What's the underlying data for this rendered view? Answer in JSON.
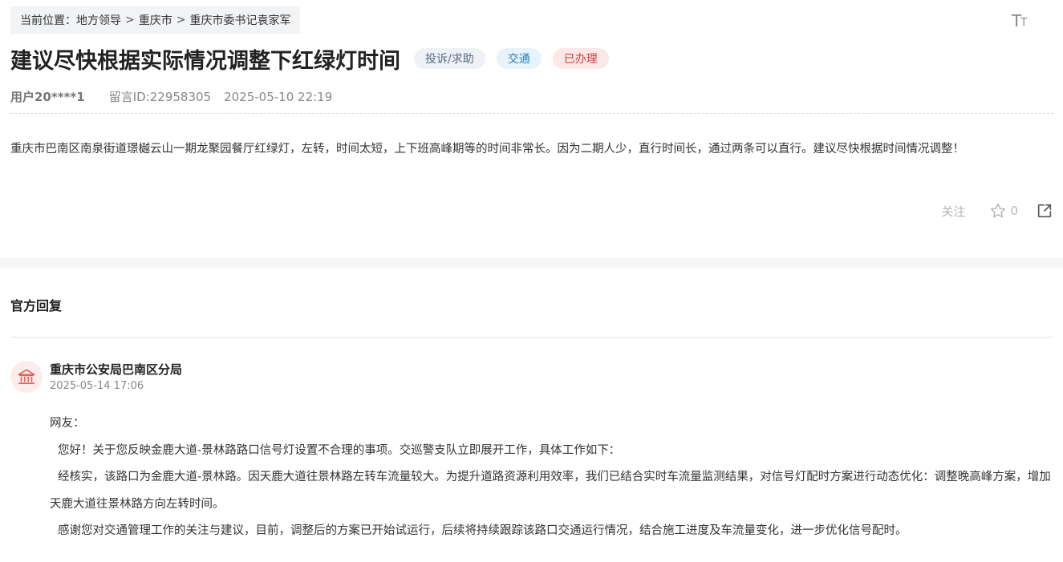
{
  "breadcrumb": {
    "prefix": "当前位置：",
    "items": [
      "地方领导",
      "重庆市",
      "重庆市委书记袁家军"
    ],
    "separator": ">"
  },
  "font_toggle": {
    "big": "T",
    "small": "T"
  },
  "post": {
    "title": "建议尽快根据实际情况调整下红绿灯时间",
    "tags": [
      {
        "label": "投诉/求助",
        "color": "#5b6a82"
      },
      {
        "label": "交通",
        "color": "#2a7fb8"
      },
      {
        "label": "已办理",
        "color": "#d43a3a"
      }
    ],
    "user": "用户20****1",
    "message_id": "留言ID:22958305",
    "datetime": "2025-05-10 22:19",
    "content": "重庆市巴南区南泉街道璟樾云山一期龙聚园餐厅红绿灯，左转，时间太短，上下班高峰期等的时间非常长。因为二期人少，直行时间长，通过两条可以直行。建议尽快根据时间情况调整！"
  },
  "actions": {
    "follow_label": "关注",
    "star_count": "0",
    "star_icon": "star-outline-icon",
    "share_icon": "share-icon"
  },
  "reply": {
    "section_title": "官方回复",
    "org_name": "重庆市公安局巴南区分局",
    "org_icon": "government-building-icon",
    "datetime": "2025-05-14 17:06",
    "paragraphs": [
      "网友：",
      "您好！关于您反映金鹿大道-景林路路口信号灯设置不合理的事项。交巡警支队立即展开工作，具体工作如下：",
      "经核实，该路口为金鹿大道-景林路。因天鹿大道往景林路左转车流量较大。为提升道路资源利用效率，我们已结合实时车流量监测结果，对信号灯配时方案进行动态优化：调整晚高峰方案，增加天鹿大道往景林路方向左转时间。",
      "感谢您对交通管理工作的关注与建议，目前，调整后的方案已开始试运行，后续将持续跟踪该路口交通运行情况，结合施工进度及车流量变化，进一步优化信号配时。"
    ]
  },
  "colors": {
    "accent_red": "#d43a3a",
    "section_band": "#f5f6f8",
    "breadcrumb_bg": "#f2f3f5"
  }
}
